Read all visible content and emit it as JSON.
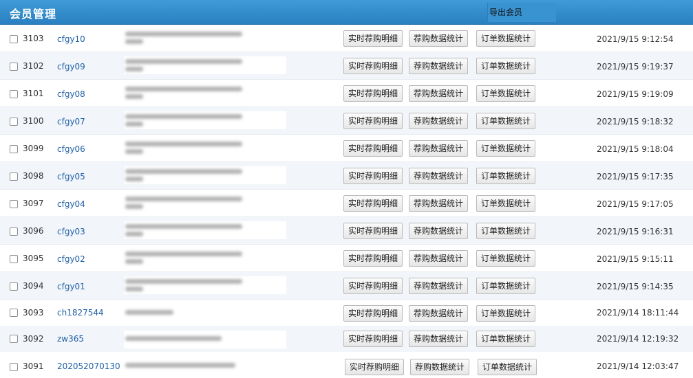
{
  "header": {
    "title": "会员管理",
    "export_label": "导出会员"
  },
  "buttons": {
    "detail": "实时荐购明细",
    "recommend_stats": "荐购数据统计",
    "order_stats": "订单数据统计"
  },
  "rows": [
    {
      "id": "3103",
      "username": "cfgy10",
      "time": "2021/9/15 9:12:54"
    },
    {
      "id": "3102",
      "username": "cfgy09",
      "time": "2021/9/15 9:19:37"
    },
    {
      "id": "3101",
      "username": "cfgy08",
      "time": "2021/9/15 9:19:09"
    },
    {
      "id": "3100",
      "username": "cfgy07",
      "time": "2021/9/15 9:18:32"
    },
    {
      "id": "3099",
      "username": "cfgy06",
      "time": "2021/9/15 9:18:04"
    },
    {
      "id": "3098",
      "username": "cfgy05",
      "time": "2021/9/15 9:17:35"
    },
    {
      "id": "3097",
      "username": "cfgy04",
      "time": "2021/9/15 9:17:05"
    },
    {
      "id": "3096",
      "username": "cfgy03",
      "time": "2021/9/15 9:16:31"
    },
    {
      "id": "3095",
      "username": "cfgy02",
      "time": "2021/9/15 9:15:11"
    },
    {
      "id": "3094",
      "username": "cfgy01",
      "time": "2021/9/15 9:14:35"
    },
    {
      "id": "3093",
      "username": "ch1827544",
      "time": "2021/9/14 18:11:44"
    },
    {
      "id": "3092",
      "username": "zw365",
      "time": "2021/9/14 12:19:32"
    },
    {
      "id": "3091",
      "username": "202052070130",
      "time": "2021/9/14 12:03:47"
    }
  ]
}
